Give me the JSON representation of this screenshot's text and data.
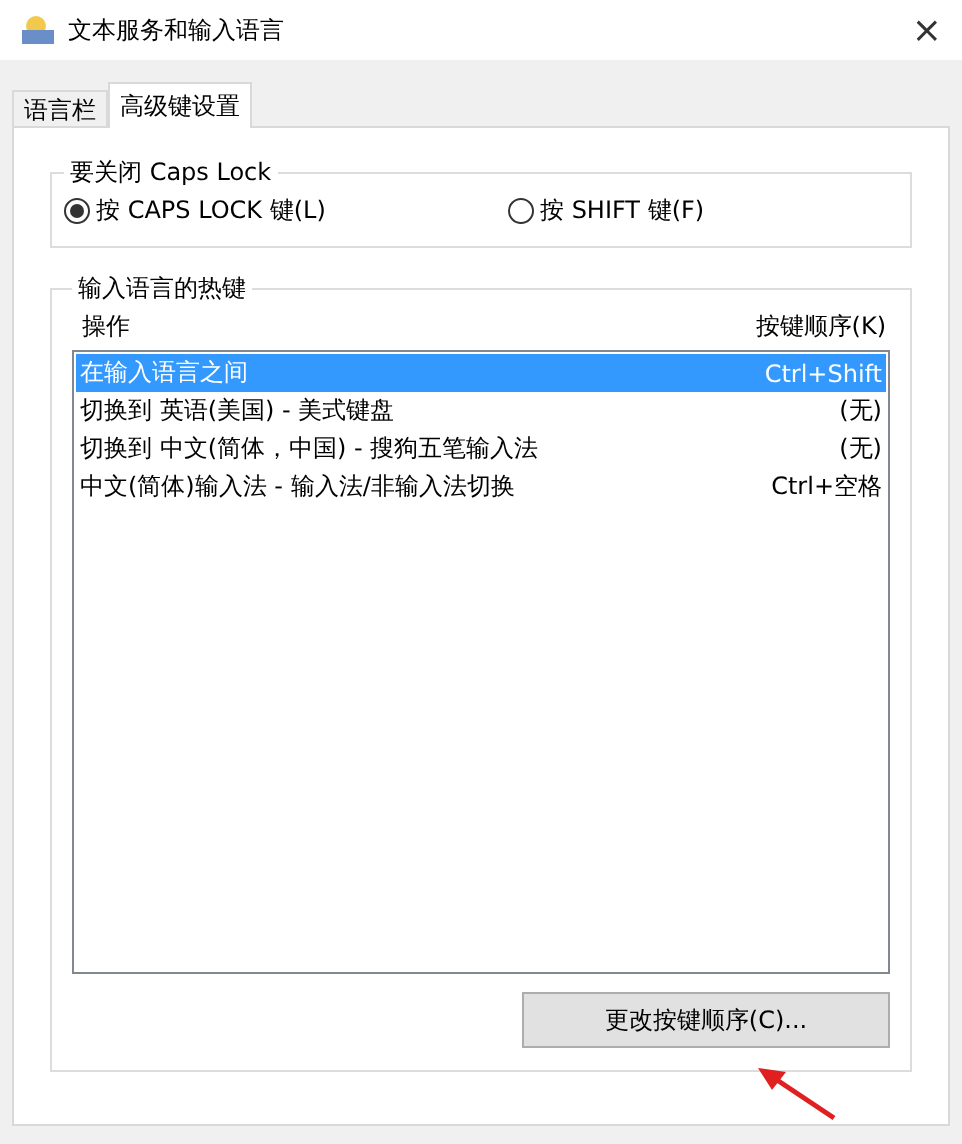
{
  "window": {
    "title": "文本服务和输入语言",
    "close": "×"
  },
  "tabs": [
    {
      "label": "语言栏",
      "selected": false
    },
    {
      "label": "高级键设置",
      "selected": true
    }
  ],
  "caps_lock_group": {
    "title": "要关闭 Caps Lock",
    "options": [
      {
        "label": "按 CAPS LOCK 键(L)",
        "selected": true
      },
      {
        "label": "按 SHIFT 键(F)",
        "selected": false
      }
    ]
  },
  "hotkeys_group": {
    "title": "输入语言的热键",
    "columns": [
      "操作",
      "按键顺序(K)"
    ],
    "rows": [
      {
        "action": "在输入语言之间",
        "keys": "Ctrl+Shift",
        "selected": true
      },
      {
        "action": "切换到 英语(美国) - 美式键盘",
        "keys": "(无)",
        "selected": false
      },
      {
        "action": "切换到 中文(简体，中国) - 搜狗五笔输入法",
        "keys": "(无)",
        "selected": false
      },
      {
        "action": "中文(简体)输入法 - 输入法/非输入法切换",
        "keys": "Ctrl+空格",
        "selected": false
      }
    ],
    "button": "更改按键顺序(C)..."
  }
}
